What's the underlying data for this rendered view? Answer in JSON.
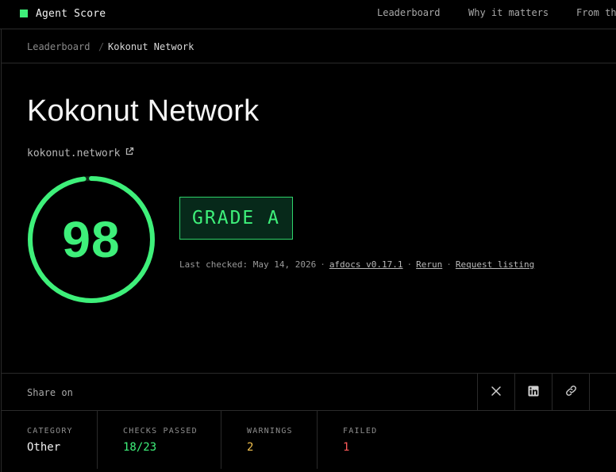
{
  "brand": {
    "name": "Agent Score"
  },
  "nav": {
    "links": [
      "Leaderboard",
      "Why it matters",
      "From the"
    ]
  },
  "breadcrumb": {
    "parent": "Leaderboard",
    "separator": "/",
    "current": "Kokonut Network"
  },
  "site": {
    "title": "Kokonut Network",
    "domain": "kokonut.network"
  },
  "score": {
    "value": "98",
    "fraction": 0.98
  },
  "grade": {
    "label": "GRADE A"
  },
  "meta": {
    "last_checked": "Last checked: May 14, 2026",
    "tool": "afdocs v0.17.1",
    "rerun": "Rerun",
    "request": "Request listing"
  },
  "share": {
    "label": "Share on"
  },
  "stats": {
    "category_label": "CATEGORY",
    "category_value": "Other",
    "checks_label": "CHECKS PASSED",
    "checks_value": "18/23",
    "warnings_label": "WARNINGS",
    "warnings_value": "2",
    "failed_label": "FAILED",
    "failed_value": "1"
  },
  "colors": {
    "accent": "#3ef07a",
    "warning": "#f2c14e",
    "failed": "#ff5a5a"
  }
}
